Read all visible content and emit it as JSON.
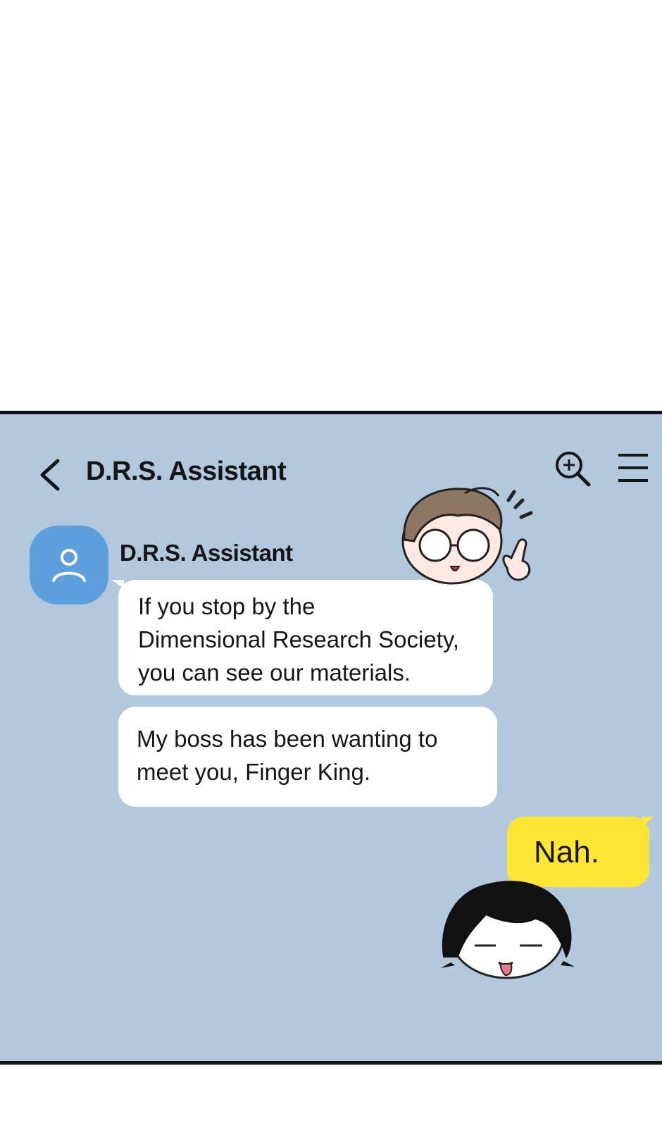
{
  "header": {
    "title": "D.R.S. Assistant"
  },
  "icons": {
    "back": "chevron-left-icon",
    "search": "zoom-in-search-icon",
    "menu": "hamburger-menu-icon",
    "avatar": "person-icon"
  },
  "colors": {
    "chat_background": "#b2c8dd",
    "incoming_bubble": "#ffffff",
    "outgoing_bubble": "#ffe535",
    "avatar": "#5d9edc"
  },
  "messages": [
    {
      "sender": "D.R.S. Assistant",
      "direction": "incoming",
      "lines": [
        "If you stop by the",
        "Dimensional Research Society,",
        "you can see our materials."
      ]
    },
    {
      "direction": "incoming",
      "lines": [
        "My boss has been wanting to",
        "meet you, Finger King."
      ]
    },
    {
      "direction": "outgoing",
      "text": "Nah."
    }
  ]
}
